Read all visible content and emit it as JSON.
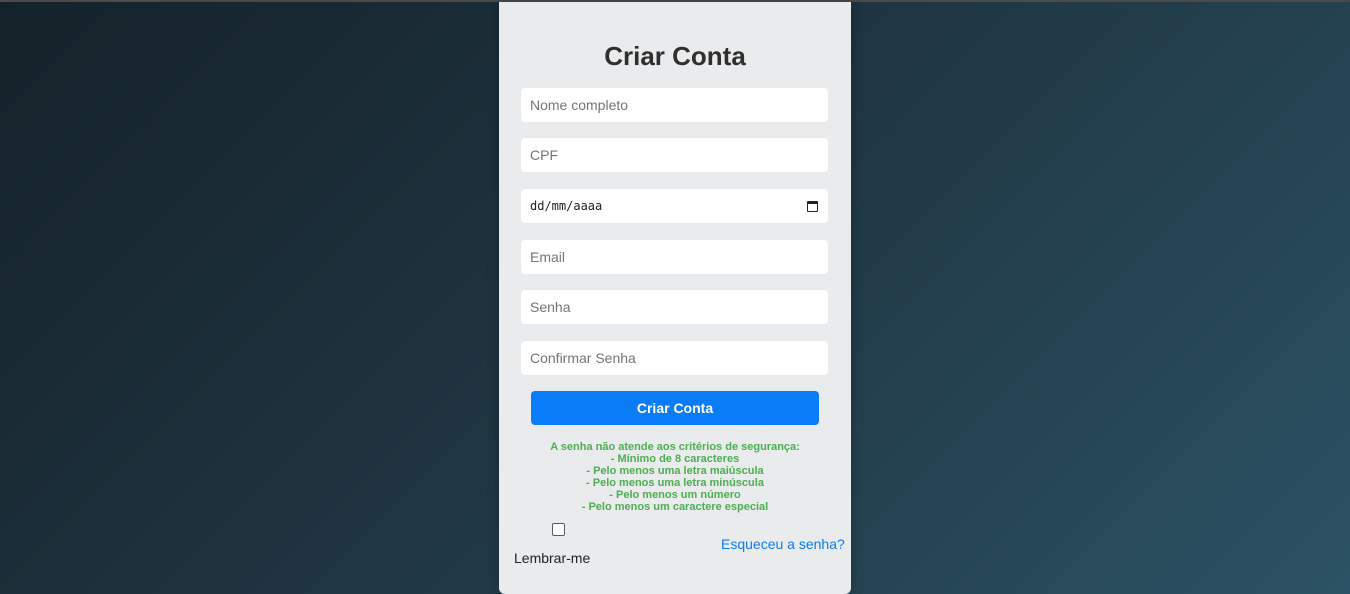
{
  "form": {
    "title": "Criar Conta",
    "fields": {
      "nome": {
        "placeholder": "Nome completo"
      },
      "cpf": {
        "placeholder": "CPF"
      },
      "data_nascimento": {
        "placeholder": "dd/mm/aaaa"
      },
      "email": {
        "placeholder": "Email"
      },
      "senha": {
        "placeholder": "Senha"
      },
      "confirmar_senha": {
        "placeholder": "Confirmar Senha"
      }
    },
    "submit_label": "Criar Conta",
    "password_message": {
      "color": "#4caf50",
      "lines": [
        "A senha não atende aos critérios de segurança:",
        "- Mínimo de 8 caracteres",
        "- Pelo menos uma letra maiúscula",
        "- Pelo menos uma letra minúscula",
        "- Pelo menos um número",
        "- Pelo menos um caractere especial"
      ]
    },
    "remember_label": "Lembrar-me",
    "remember_checked": false,
    "forgot_link": "Esqueceu a senha?"
  },
  "colors": {
    "accent": "#0a7cf7",
    "card_background": "#e9ebec",
    "page_background_dark": "#142129",
    "page_background_light": "#2b5264"
  },
  "icons": {
    "date_picker": "calendar-icon"
  }
}
